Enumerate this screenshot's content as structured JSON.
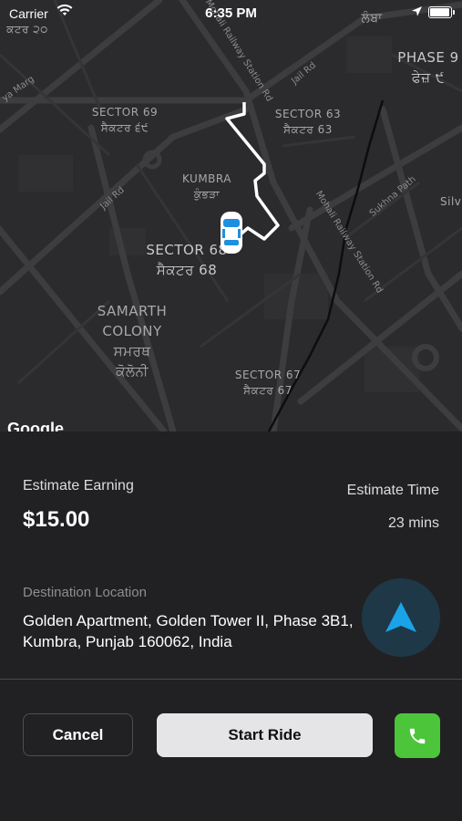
{
  "status_bar": {
    "carrier": "Carrier",
    "time": "6:35 PM"
  },
  "map": {
    "labels": {
      "sector69": [
        "SECTOR 69",
        "ਸੈਕਟਰ ੬੯"
      ],
      "sector63": [
        "SECTOR 63",
        "ਸੈਕਟਰ 63"
      ],
      "kumbra": [
        "KUMBRA",
        "ਕੁੰਭੜਾ"
      ],
      "sector68": [
        "SECTOR 68",
        "ਸੈਕਟਰ 68"
      ],
      "samarth": [
        "SAMARTH",
        "COLONY",
        "ਸਮਰਥ",
        "ਕੋਲੋਨੀ"
      ],
      "sector67": [
        "SECTOR 67",
        "ਸੈਕਟਰ 67"
      ],
      "phase9": [
        "PHASE 9",
        "ਫੇਜ਼ ੯"
      ],
      "lamba": "ਲੰਬਾ",
      "sector20": "ਕਟਰ ੨੦",
      "silv": "Silv"
    },
    "roads": {
      "jail_rd_top": "Jail Rd",
      "jail_rd_left": "Jail Rd",
      "ya_marg": "ya Marg",
      "mohali_station_top": "Mohali Railway Station Rd",
      "mohali_station_mid": "Mohali Railway Station Rd",
      "sukhna_path": "Sukhna Path"
    },
    "attribution": "Google"
  },
  "trip": {
    "estimate_earning_label": "Estimate Earning",
    "estimate_earning_value": "$15.00",
    "estimate_time_label": "Estimate Time",
    "estimate_time_value": "23 mins",
    "destination_label": "Destination Location",
    "destination_value": "Golden Apartment, Golden Tower II, Phase 3B1, Kumbra, Punjab 160062, India"
  },
  "actions": {
    "cancel_label": "Cancel",
    "start_label": "Start Ride"
  },
  "icons": {
    "navigation": "navigation-arrow-icon",
    "call": "phone-icon",
    "car": "car-icon",
    "wifi": "wifi-icon",
    "location": "location-arrow-icon",
    "battery": "battery-icon"
  },
  "colors": {
    "panel_bg": "#212123",
    "map_bg": "#2b2b2d",
    "nav_accent": "#1aa3e8",
    "call_green": "#4cc53a",
    "route": "#ffffff"
  }
}
